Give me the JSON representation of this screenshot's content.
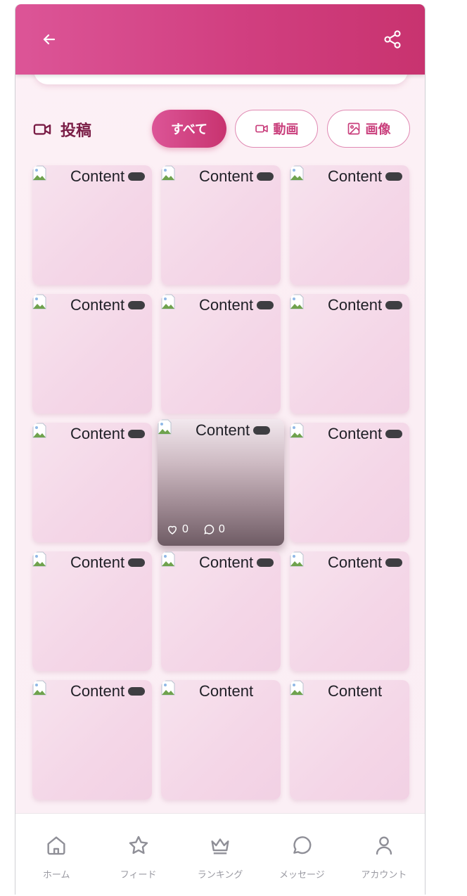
{
  "header": {
    "back_icon": "arrow-left-icon",
    "share_icon": "share-icon",
    "gradient": [
      "#dc5597",
      "#c8336f"
    ]
  },
  "section": {
    "title": "投稿",
    "icon": "video-icon"
  },
  "filters": [
    {
      "label": "すべて",
      "active": true
    },
    {
      "label": "動画",
      "icon": "video-icon"
    },
    {
      "label": "画像",
      "icon": "image-icon"
    }
  ],
  "tiles": [
    {
      "label": "Content"
    },
    {
      "label": "Content"
    },
    {
      "label": "Content"
    },
    {
      "label": "Content"
    },
    {
      "label": "Content"
    },
    {
      "label": "Content"
    },
    {
      "label": "Content"
    },
    {
      "label": "Content",
      "likes": "0",
      "comments": "0"
    },
    {
      "label": "Content"
    },
    {
      "label": "Content"
    },
    {
      "label": "Content"
    },
    {
      "label": "Content"
    },
    {
      "label": "Content"
    },
    {
      "label": "Content"
    },
    {
      "label": "Content"
    }
  ],
  "nav": [
    {
      "label": "ホーム",
      "icon": "home-icon"
    },
    {
      "label": "フィード",
      "icon": "star-icon"
    },
    {
      "label": "ランキング",
      "icon": "crown-icon"
    },
    {
      "label": "メッセージ",
      "icon": "chat-icon"
    },
    {
      "label": "アカウント",
      "icon": "user-icon"
    }
  ],
  "colors": {
    "accent": "#d13f80",
    "title": "#7a1d46",
    "nav_text": "#9a9aa2"
  }
}
